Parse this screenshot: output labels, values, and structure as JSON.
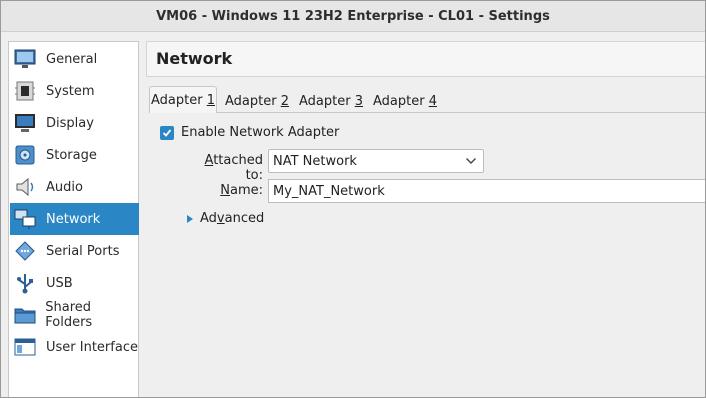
{
  "window": {
    "title": "VM06 - Windows 11 23H2 Enterprise - CL01 - Settings"
  },
  "sidebar": {
    "selected": "Network",
    "accent_color": "#2a86c4",
    "items": [
      {
        "label": "General",
        "icon": "general-icon"
      },
      {
        "label": "System",
        "icon": "system-icon"
      },
      {
        "label": "Display",
        "icon": "display-icon"
      },
      {
        "label": "Storage",
        "icon": "storage-icon"
      },
      {
        "label": "Audio",
        "icon": "audio-icon"
      },
      {
        "label": "Network",
        "icon": "network-icon"
      },
      {
        "label": "Serial Ports",
        "icon": "serial-ports-icon"
      },
      {
        "label": "USB",
        "icon": "usb-icon"
      },
      {
        "label": "Shared Folders",
        "icon": "shared-folders-icon"
      },
      {
        "label": "User Interface",
        "icon": "user-interface-icon"
      }
    ]
  },
  "page": {
    "title": "Network"
  },
  "tabs": [
    {
      "label": "Adapter ",
      "mnemonic": "1",
      "active": true
    },
    {
      "label": "Adapter ",
      "mnemonic": "2",
      "active": false
    },
    {
      "label": "Adapter ",
      "mnemonic": "3",
      "active": false
    },
    {
      "label": "Adapter ",
      "mnemonic": "4",
      "active": false
    }
  ],
  "adapter": {
    "enable_label": "Enable Network Adapter",
    "enabled": true,
    "attached_label_mnemonic": "A",
    "attached_label_rest": "ttached to:",
    "attached_value": "NAT Network",
    "name_label_mnemonic": "N",
    "name_label_rest": "ame:",
    "name_value": "My_NAT_Network",
    "advanced_label_pre": "Ad",
    "advanced_label_mnemonic": "v",
    "advanced_label_post": "anced"
  }
}
